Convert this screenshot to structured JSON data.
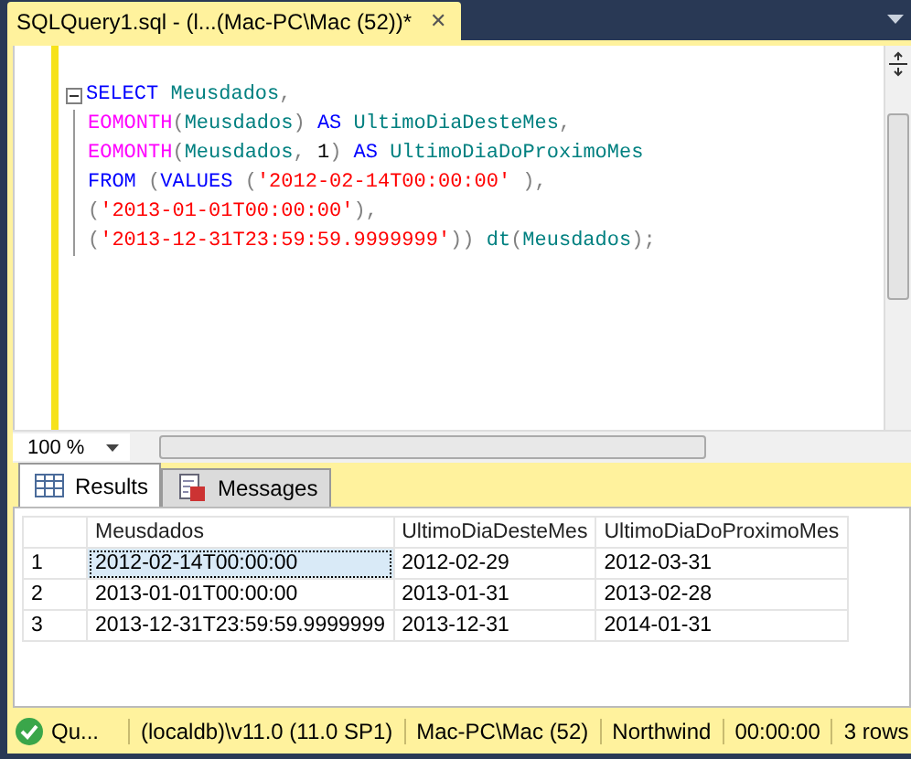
{
  "document_tab": {
    "title": "SQLQuery1.sql - (l...(Mac-PC\\Mac (52))*",
    "close": "✕"
  },
  "code_lines": [
    {
      "tokens": [
        {
          "text": "SELECT ",
          "kind": "keyword"
        },
        {
          "text": "Meusdados",
          "kind": "ident"
        },
        {
          "text": ",",
          "kind": "punct"
        }
      ],
      "collapsible": true
    },
    {
      "tokens": [
        {
          "text": "EOMONTH",
          "kind": "function"
        },
        {
          "text": "(",
          "kind": "punct"
        },
        {
          "text": "Meusdados",
          "kind": "ident"
        },
        {
          "text": ") ",
          "kind": "punct"
        },
        {
          "text": "AS ",
          "kind": "keyword"
        },
        {
          "text": "UltimoDiaDesteMes",
          "kind": "ident"
        },
        {
          "text": ",",
          "kind": "punct"
        }
      ],
      "collapsible": false
    },
    {
      "tokens": [
        {
          "text": "EOMONTH",
          "kind": "function"
        },
        {
          "text": "(",
          "kind": "punct"
        },
        {
          "text": "Meusdados",
          "kind": "ident"
        },
        {
          "text": ", ",
          "kind": "punct"
        },
        {
          "text": "1",
          "kind": "number"
        },
        {
          "text": ") ",
          "kind": "punct"
        },
        {
          "text": "AS ",
          "kind": "keyword"
        },
        {
          "text": "UltimoDiaDoProximoMes",
          "kind": "ident"
        }
      ],
      "collapsible": false
    },
    {
      "tokens": [
        {
          "text": "FROM ",
          "kind": "keyword"
        },
        {
          "text": "(",
          "kind": "punct"
        },
        {
          "text": "VALUES ",
          "kind": "keyword"
        },
        {
          "text": "(",
          "kind": "punct"
        },
        {
          "text": "'2012-02-14T00:00:00'",
          "kind": "string"
        },
        {
          "text": " ),",
          "kind": "punct"
        }
      ],
      "collapsible": false
    },
    {
      "tokens": [
        {
          "text": "(",
          "kind": "punct"
        },
        {
          "text": "'2013-01-01T00:00:00'",
          "kind": "string"
        },
        {
          "text": "),",
          "kind": "punct"
        }
      ],
      "collapsible": false
    },
    {
      "tokens": [
        {
          "text": "(",
          "kind": "punct"
        },
        {
          "text": "'2013-12-31T23:59:59.9999999'",
          "kind": "string"
        },
        {
          "text": ")) ",
          "kind": "punct"
        },
        {
          "text": "dt",
          "kind": "ident"
        },
        {
          "text": "(",
          "kind": "punct"
        },
        {
          "text": "Meusdados",
          "kind": "ident"
        },
        {
          "text": ");",
          "kind": "punct"
        }
      ],
      "collapsible": false
    }
  ],
  "zoom": {
    "value": "100 %"
  },
  "result_tabs": [
    {
      "label": "Results",
      "kind": "grid",
      "selected": true
    },
    {
      "label": "Messages",
      "kind": "messages",
      "selected": false
    }
  ],
  "table": {
    "columns": [
      "Meusdados",
      "UltimoDiaDesteMes",
      "UltimoDiaDoProximoMes"
    ],
    "rows": [
      {
        "number": "1",
        "cells": [
          {
            "text": "2012-02-14T00:00:00",
            "selected": true
          },
          {
            "text": "2012-02-29",
            "selected": false
          },
          {
            "text": "2012-03-31",
            "selected": false
          }
        ]
      },
      {
        "number": "2",
        "cells": [
          {
            "text": "2013-01-01T00:00:00",
            "selected": false
          },
          {
            "text": "2013-01-31",
            "selected": false
          },
          {
            "text": "2013-02-28",
            "selected": false
          }
        ]
      },
      {
        "number": "3",
        "cells": [
          {
            "text": "2013-12-31T23:59:59.9999999",
            "selected": false
          },
          {
            "text": "2013-12-31",
            "selected": false
          },
          {
            "text": "2014-01-31",
            "selected": false
          }
        ]
      }
    ]
  },
  "status_bar": {
    "status": "Qu...",
    "items": [
      "(localdb)\\v11.0 (11.0 SP1)",
      "Mac-PC\\Mac (52)",
      "Northwind",
      "00:00:00",
      "3 rows"
    ]
  }
}
